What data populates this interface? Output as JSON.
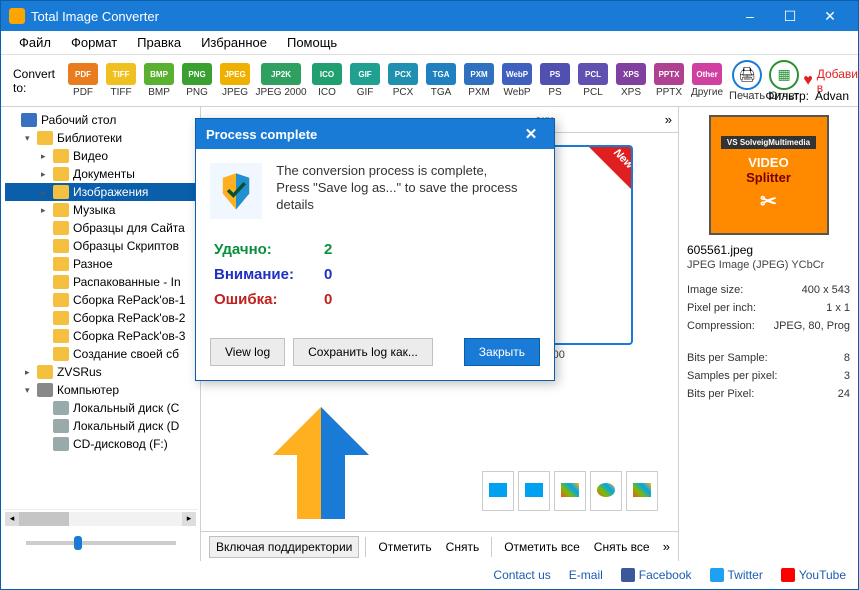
{
  "title": "Total Image Converter",
  "window_controls": {
    "min": "–",
    "max": "☐",
    "close": "✕"
  },
  "menu": [
    "Файл",
    "Формат",
    "Правка",
    "Избранное",
    "Помощь"
  ],
  "toolbar": {
    "convert_label": "Convert to:",
    "formats": [
      {
        "label": "PDF",
        "txt": "PDF",
        "color": "#e97c1f"
      },
      {
        "label": "TIFF",
        "txt": "TIFF",
        "color": "#f0c020"
      },
      {
        "label": "BMP",
        "txt": "BMP",
        "color": "#5ab030"
      },
      {
        "label": "PNG",
        "txt": "PNG",
        "color": "#3aa030"
      },
      {
        "label": "JPEG",
        "txt": "JPEG",
        "color": "#f0b000"
      },
      {
        "label": "JPEG 2000",
        "txt": "JP2K",
        "color": "#30a060",
        "wide": true
      },
      {
        "label": "ICO",
        "txt": "ICO",
        "color": "#20a070"
      },
      {
        "label": "GIF",
        "txt": "GIF",
        "color": "#20a090"
      },
      {
        "label": "PCX",
        "txt": "PCX",
        "color": "#2090b0"
      },
      {
        "label": "TGA",
        "txt": "TGA",
        "color": "#2080c0"
      },
      {
        "label": "PXM",
        "txt": "PXM",
        "color": "#3070c0"
      },
      {
        "label": "WebP",
        "txt": "WebP",
        "color": "#4060c0"
      },
      {
        "label": "PS",
        "txt": "PS",
        "color": "#5050b0"
      },
      {
        "label": "PCL",
        "txt": "PCL",
        "color": "#6050b0"
      },
      {
        "label": "XPS",
        "txt": "XPS",
        "color": "#8040a0"
      },
      {
        "label": "PPTX",
        "txt": "PPTX",
        "color": "#b04090"
      },
      {
        "label": "Другие",
        "txt": "Other",
        "color": "#d040a0"
      }
    ],
    "print_label": "Печать",
    "report_label": "Отчет",
    "fav_label": "Добавить в",
    "filter_label": "Фильтр:",
    "filter_value": "Advan"
  },
  "tree": {
    "items": [
      {
        "label": "Рабочий стол",
        "level": 1,
        "icon": "#3a70c0",
        "tgl": ""
      },
      {
        "label": "Библиотеки",
        "level": 2,
        "icon": "#f5c040",
        "tgl": "▾"
      },
      {
        "label": "Видео",
        "level": 3,
        "icon": "#f5c040",
        "tgl": "▸"
      },
      {
        "label": "Документы",
        "level": 3,
        "icon": "#f5c040",
        "tgl": "▸"
      },
      {
        "label": "Изображения",
        "level": 3,
        "icon": "#f5c040",
        "tgl": "▸",
        "sel": true
      },
      {
        "label": "Музыка",
        "level": 3,
        "icon": "#f5c040",
        "tgl": "▸"
      },
      {
        "label": "Образцы для Сайта",
        "level": 3,
        "icon": "#f5c040",
        "tgl": ""
      },
      {
        "label": "Образцы Скриптов",
        "level": 3,
        "icon": "#f5c040",
        "tgl": ""
      },
      {
        "label": "Разное",
        "level": 3,
        "icon": "#f5c040",
        "tgl": ""
      },
      {
        "label": "Распакованные - In",
        "level": 3,
        "icon": "#f5c040",
        "tgl": ""
      },
      {
        "label": "Сборка RePack'ов-1",
        "level": 3,
        "icon": "#f5c040",
        "tgl": ""
      },
      {
        "label": "Сборка RePack'ов-2",
        "level": 3,
        "icon": "#f5c040",
        "tgl": ""
      },
      {
        "label": "Сборка RePack'ов-3",
        "level": 3,
        "icon": "#f5c040",
        "tgl": ""
      },
      {
        "label": "Создание своей сб",
        "level": 3,
        "icon": "#f5c040",
        "tgl": ""
      },
      {
        "label": "ZVSRus",
        "level": 2,
        "icon": "#f5c040",
        "tgl": "▸"
      },
      {
        "label": "Компьютер",
        "level": 2,
        "icon": "#888",
        "tgl": "▾"
      },
      {
        "label": "Локальный диск (C",
        "level": 3,
        "icon": "#9aa",
        "tgl": ""
      },
      {
        "label": "Локальный диск (D",
        "level": 3,
        "icon": "#9aa",
        "tgl": ""
      },
      {
        "label": "CD-дисковод (F:)",
        "level": 3,
        "icon": "#9aa",
        "tgl": ""
      }
    ]
  },
  "tabs": {
    "t2": "аки"
  },
  "thumbs": [
    {
      "dim": "x500"
    }
  ],
  "newbadge": "New",
  "bottombar": {
    "subdirs": "Включая поддиректории",
    "mark": "Отметить",
    "unmark": "Снять",
    "markall": "Отметить все",
    "unmarkall": "Снять все"
  },
  "side": {
    "filename": "605561.jpeg",
    "format": "JPEG Image (JPEG) YCbCr",
    "rows": [
      {
        "k": "Image size:",
        "v": "400 x 543"
      },
      {
        "k": "Pixel per inch:",
        "v": "1 x 1"
      },
      {
        "k": "Compression:",
        "v": "JPEG, 80, Prog"
      },
      {
        "k": "Bits per Sample:",
        "v": "8"
      },
      {
        "k": "Samples per pixel:",
        "v": "3"
      },
      {
        "k": "Bits per Pixel:",
        "v": "24"
      }
    ]
  },
  "footer": {
    "contact": "Contact us",
    "email": "E-mail",
    "fb": "Facebook",
    "tw": "Twitter",
    "yt": "YouTube"
  },
  "dialog": {
    "title": "Process complete",
    "msg1": "The conversion process is complete,",
    "msg2": "Press \"Save log as...\" to save the process details",
    "ok_label": "Удачно:",
    "ok_val": "2",
    "warn_label": "Внимание:",
    "warn_val": "0",
    "err_label": "Ошибка:",
    "err_val": "0",
    "viewlog": "View log",
    "savelog": "Сохранить log как...",
    "close": "Закрыть"
  }
}
